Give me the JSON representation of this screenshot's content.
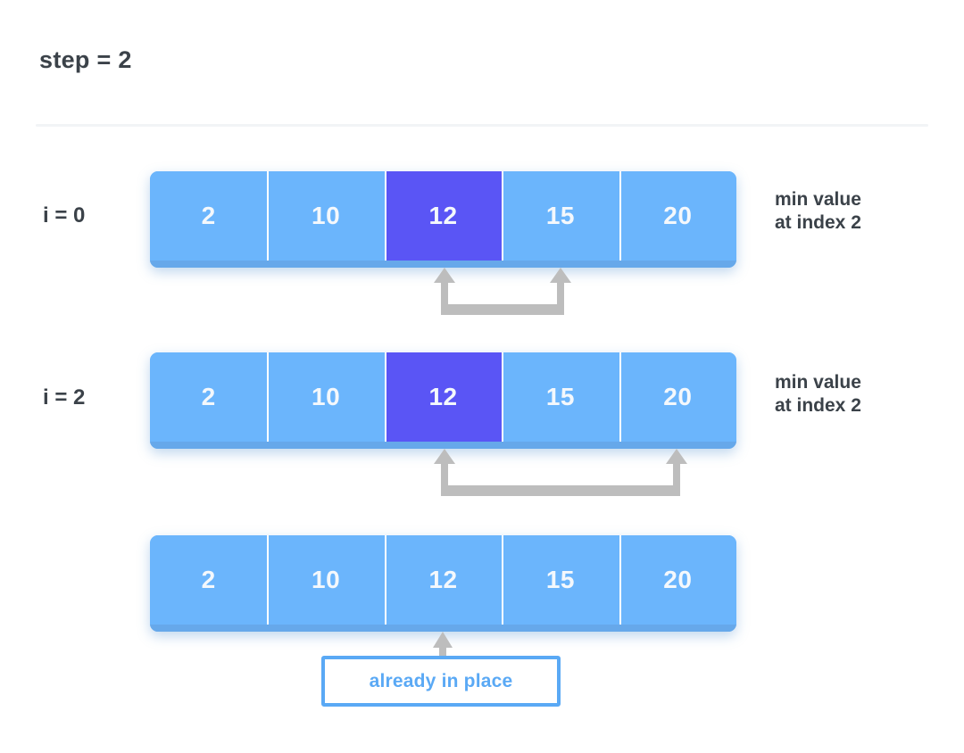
{
  "header": {
    "step_label": "step = 2",
    "divider_color": "#f2f4f6"
  },
  "colors": {
    "cell": "#6bb5fc",
    "cell_highlight": "#5a55f5",
    "cell_base_strip": "#66a8ea",
    "cell_text": "#f4f8fc",
    "label_text": "#3b4249",
    "connector": "#bdbdbd",
    "callout_accent": "#5aa9f5"
  },
  "rows": [
    {
      "left_label": "i = 0",
      "right_label": "min value\nat index 2",
      "cells": [
        {
          "value": "2",
          "highlight": false
        },
        {
          "value": "10",
          "highlight": false
        },
        {
          "value": "12",
          "highlight": true
        },
        {
          "value": "15",
          "highlight": false
        },
        {
          "value": "20",
          "highlight": false
        }
      ],
      "connector": {
        "from_index": 2,
        "to_index": 3
      }
    },
    {
      "left_label": "i = 2",
      "right_label": "min value\nat index 2",
      "cells": [
        {
          "value": "2",
          "highlight": false
        },
        {
          "value": "10",
          "highlight": false
        },
        {
          "value": "12",
          "highlight": true
        },
        {
          "value": "15",
          "highlight": false
        },
        {
          "value": "20",
          "highlight": false
        }
      ],
      "connector": {
        "from_index": 2,
        "to_index": 4
      }
    },
    {
      "left_label": "",
      "right_label": "",
      "cells": [
        {
          "value": "2",
          "highlight": false
        },
        {
          "value": "10",
          "highlight": false
        },
        {
          "value": "12",
          "highlight": false
        },
        {
          "value": "15",
          "highlight": false
        },
        {
          "value": "20",
          "highlight": false
        }
      ],
      "connector": null
    }
  ],
  "callout": {
    "text": "already in place",
    "points_at_index": 2
  }
}
